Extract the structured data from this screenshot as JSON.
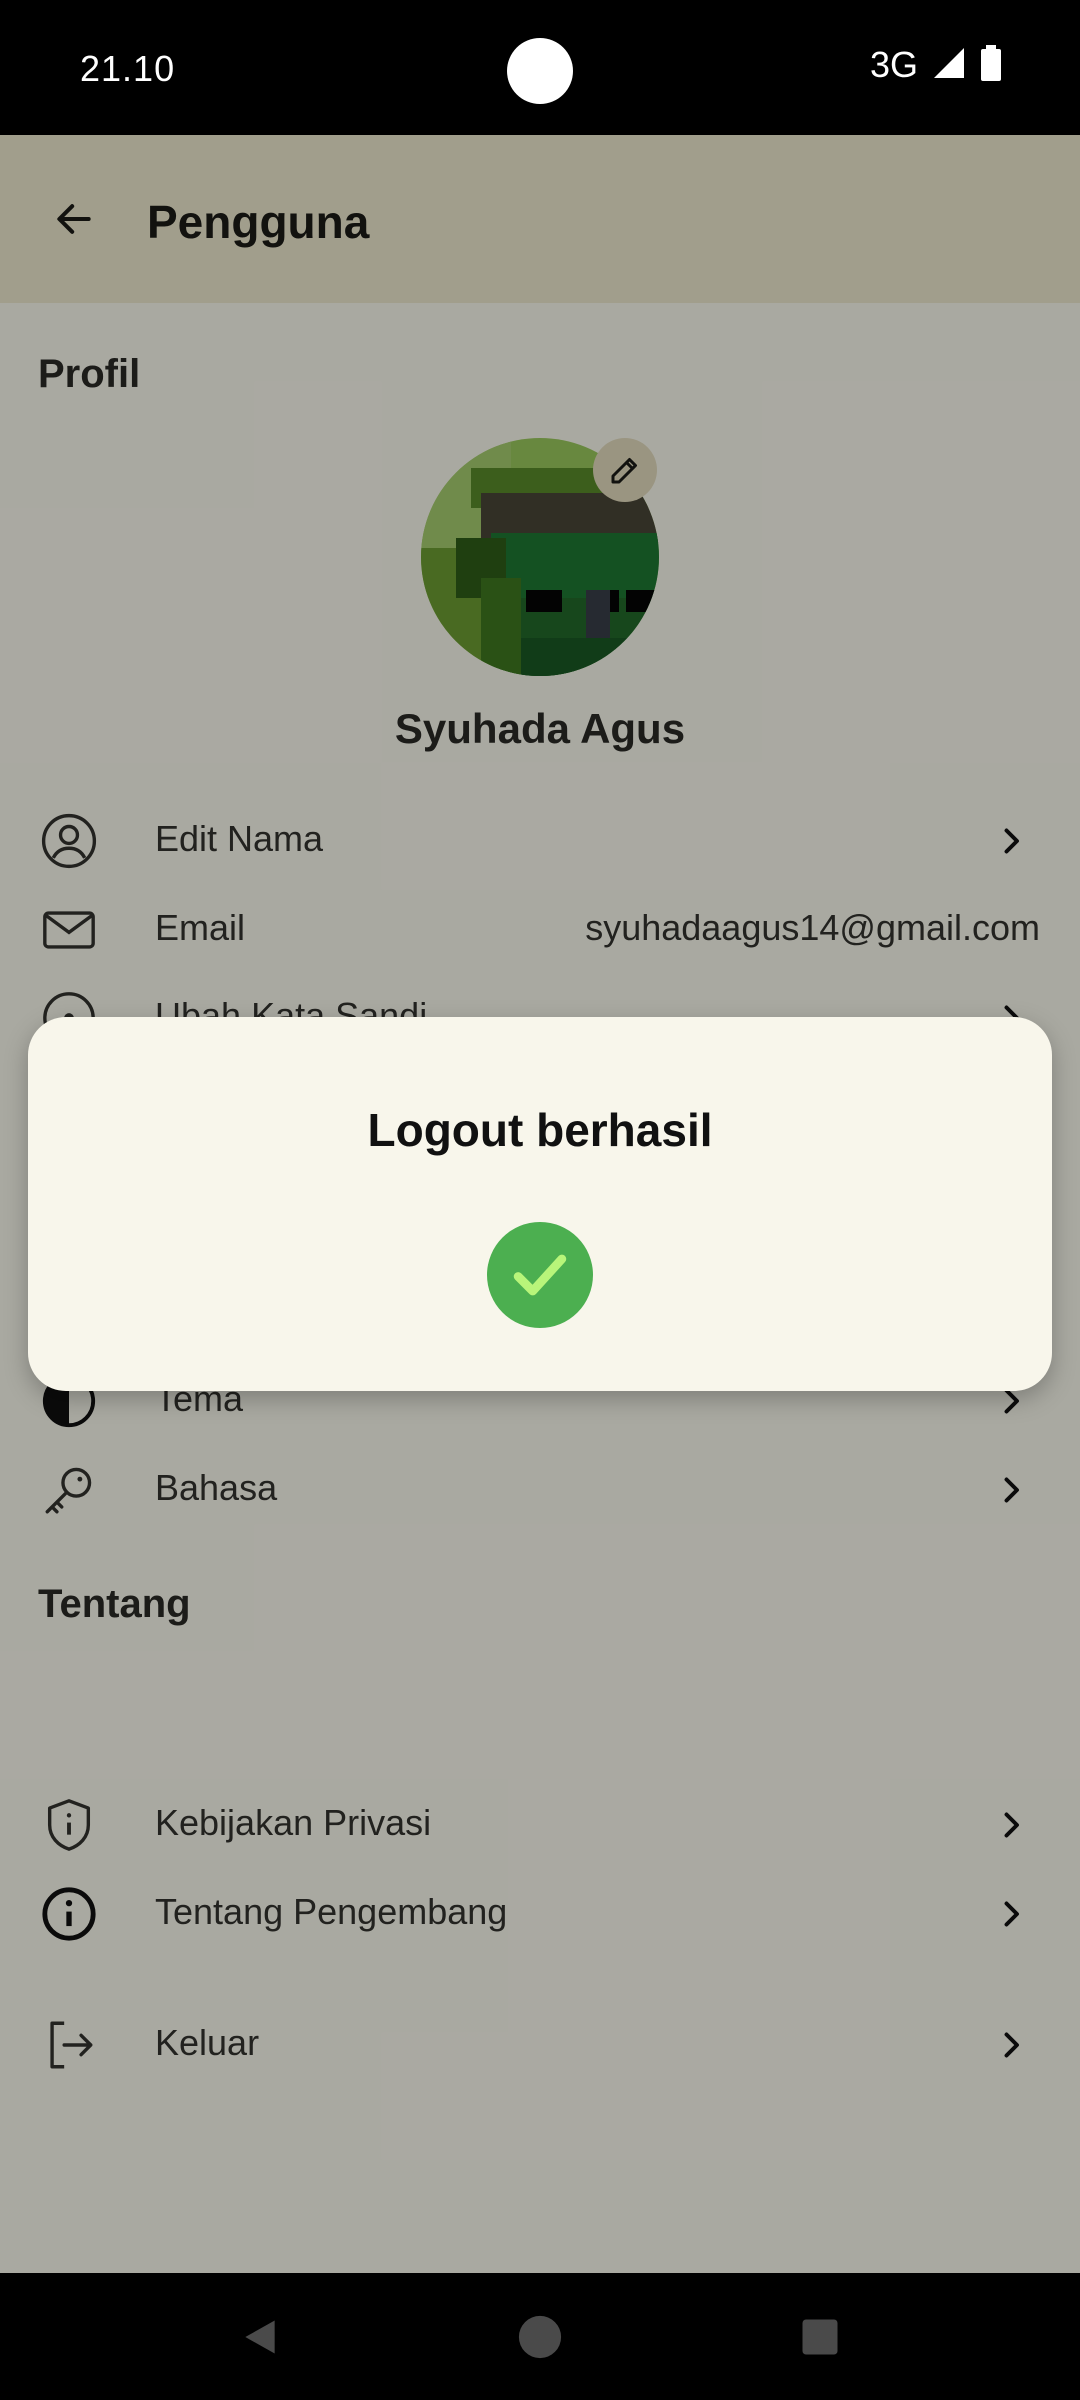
{
  "status_bar": {
    "time": "21.10",
    "network": "3G"
  },
  "appbar": {
    "title": "Pengguna"
  },
  "profile": {
    "section_title": "Profil",
    "user_name": "Syuhada Agus",
    "rows": [
      {
        "label": "Edit Nama",
        "icon": "user-circle-icon"
      },
      {
        "label": "Email",
        "value": "syuhadaagus14@gmail.com",
        "icon": "mail-icon"
      },
      {
        "label": "Ubah Kata Sandi",
        "icon": "lock-icon"
      }
    ]
  },
  "settings": {
    "rows": [
      {
        "label": "Tema",
        "icon": "theme-icon"
      },
      {
        "label": "Bahasa",
        "icon": "key-icon"
      }
    ]
  },
  "about": {
    "section_title": "Tentang",
    "rows": [
      {
        "label": "Kebijakan Privasi",
        "icon": "shield-info-icon"
      },
      {
        "label": "Tentang Pengembang",
        "icon": "info-icon"
      }
    ]
  },
  "logout": {
    "label": "Keluar",
    "icon": "logout-icon"
  },
  "dialog": {
    "title": "Logout berhasil",
    "icon": "check-circle-icon",
    "accent": "#4caf50"
  },
  "colors": {
    "appbar": "#f1ecd1",
    "background": "#fdfcf1",
    "dialog": "#f8f6eb"
  }
}
